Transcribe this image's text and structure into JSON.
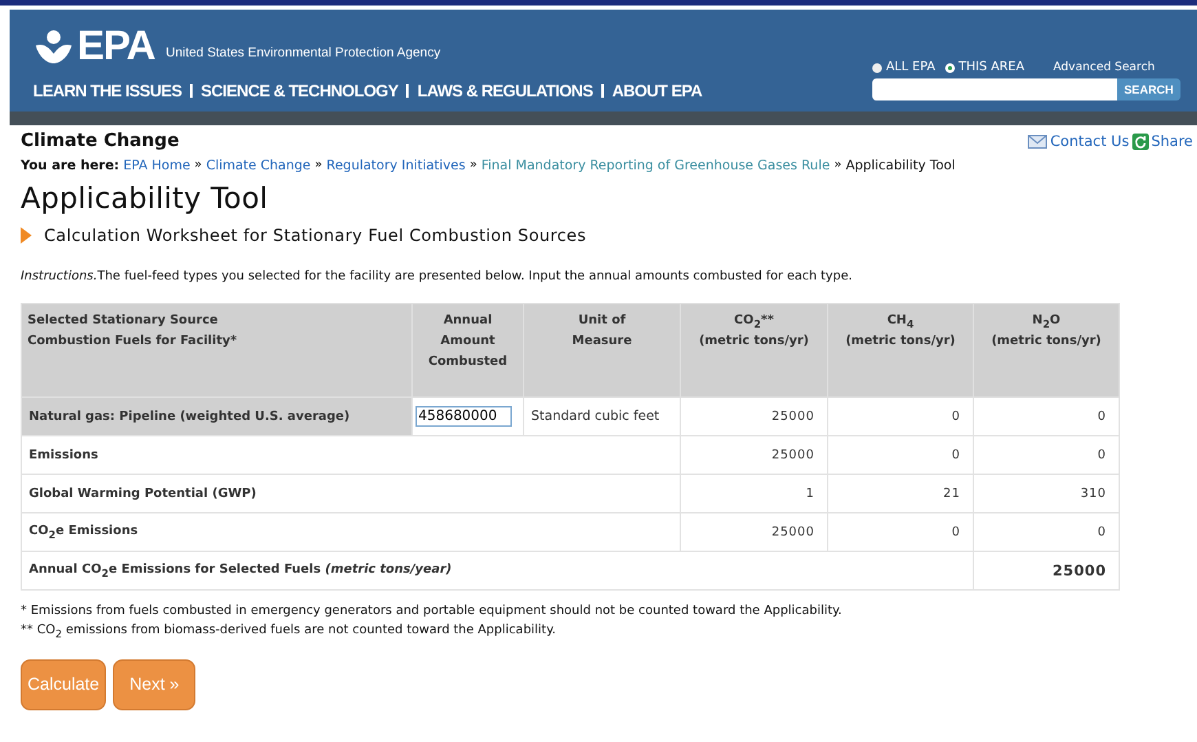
{
  "header": {
    "logo": "EPA",
    "agency": "United States Environmental Protection Agency",
    "nav": [
      "LEARN THE ISSUES",
      "SCIENCE & TECHNOLOGY",
      "LAWS & REGULATIONS",
      "ABOUT EPA"
    ],
    "scope": [
      {
        "label": "ALL EPA",
        "selected": false
      },
      {
        "label": "THIS AREA",
        "selected": true
      }
    ],
    "advanced_search": "Advanced Search",
    "search_button": "SEARCH"
  },
  "section": "Climate Change",
  "contact": "Contact Us",
  "share": "Share",
  "breadcrumb": {
    "prefix": "You are here:",
    "links": [
      "EPA Home",
      "Climate Change",
      "Regulatory Initiatives",
      "Final Mandatory Reporting of Greenhouse Gases Rule"
    ],
    "current": "Applicability Tool",
    "separator": "»"
  },
  "title": "Applicability Tool",
  "subtitle": "Calculation Worksheet for Stationary Fuel Combustion Sources",
  "instructions": {
    "label": "Instructions.",
    "text": "The fuel-feed types you selected for the facility are presented below. Input the annual amounts combusted for each type."
  },
  "table": {
    "columns": [
      {
        "label": "Selected Stationary Source Combustion Fuels for Facility*"
      },
      {
        "label": "Annual Amount Combusted"
      },
      {
        "label": "Unit of Measure"
      },
      {
        "label": "CO$_{2}$**",
        "unit": "(metric tons/yr)"
      },
      {
        "label": "CH$_{4}$",
        "unit": "(metric tons/yr)"
      },
      {
        "label": "N$_{2}$O",
        "unit": "(metric tons/yr)"
      }
    ],
    "rows": [
      {
        "kind": "fuel",
        "label": "Natural gas: Pipeline (weighted U.S. average)",
        "amount": "458680000",
        "unit": "Standard cubic feet",
        "values": [
          "25000",
          "0",
          "0"
        ]
      },
      {
        "kind": "plain",
        "label": "Emissions",
        "values": [
          "25000",
          "0",
          "0"
        ]
      },
      {
        "kind": "plain",
        "label": "Global Warming Potential (GWP)",
        "values": [
          "1",
          "21",
          "310"
        ]
      },
      {
        "kind": "plain",
        "label": "CO$_{2}$e Emissions",
        "values": [
          "25000",
          "0",
          "0"
        ]
      },
      {
        "kind": "total",
        "label": "Annual CO$_{2}$e Emissions for Selected Fuels *(metric tons/year)*",
        "values": [
          "25000"
        ]
      }
    ]
  },
  "notes": [
    "* Emissions from fuels combusted in emergency generators and portable equipment should not be counted toward the Applicability.",
    "** CO$_{2}$ emissions from biomass-derived fuels are not counted toward the Applicability."
  ],
  "buttons": [
    "Calculate",
    "Next »"
  ]
}
